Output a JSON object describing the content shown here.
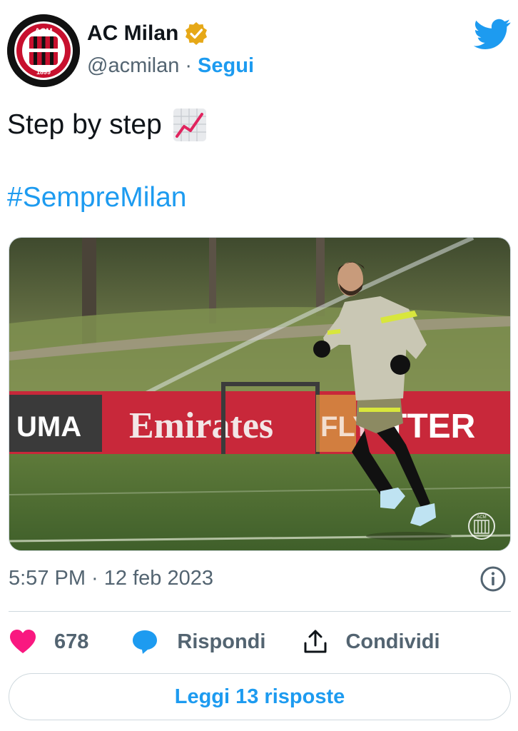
{
  "author": {
    "name": "AC Milan",
    "handle": "@acmilan",
    "separator": "·",
    "follow_label": "Segui",
    "avatar_text": "ACM",
    "avatar_year": "1899",
    "verified_color": "#e6a817"
  },
  "tweet": {
    "text": "Step by step",
    "emoji_icon": "chart-increasing-icon",
    "hashtag": "#SempreMilan"
  },
  "photo": {
    "banner_texts": [
      "UMA",
      "Emirates",
      "FLY",
      "TTER"
    ],
    "watermark": "ACM"
  },
  "meta": {
    "timestamp": "5:57 PM · 12 feb 2023"
  },
  "actions": {
    "like_count": "678",
    "reply_label": "Rispondi",
    "share_label": "Condividi"
  },
  "footer": {
    "read_replies_label": "Leggi 13 risposte"
  },
  "colors": {
    "accent": "#1d9bf0",
    "like": "#f91880",
    "text": "#0f1419",
    "muted": "#536471"
  }
}
